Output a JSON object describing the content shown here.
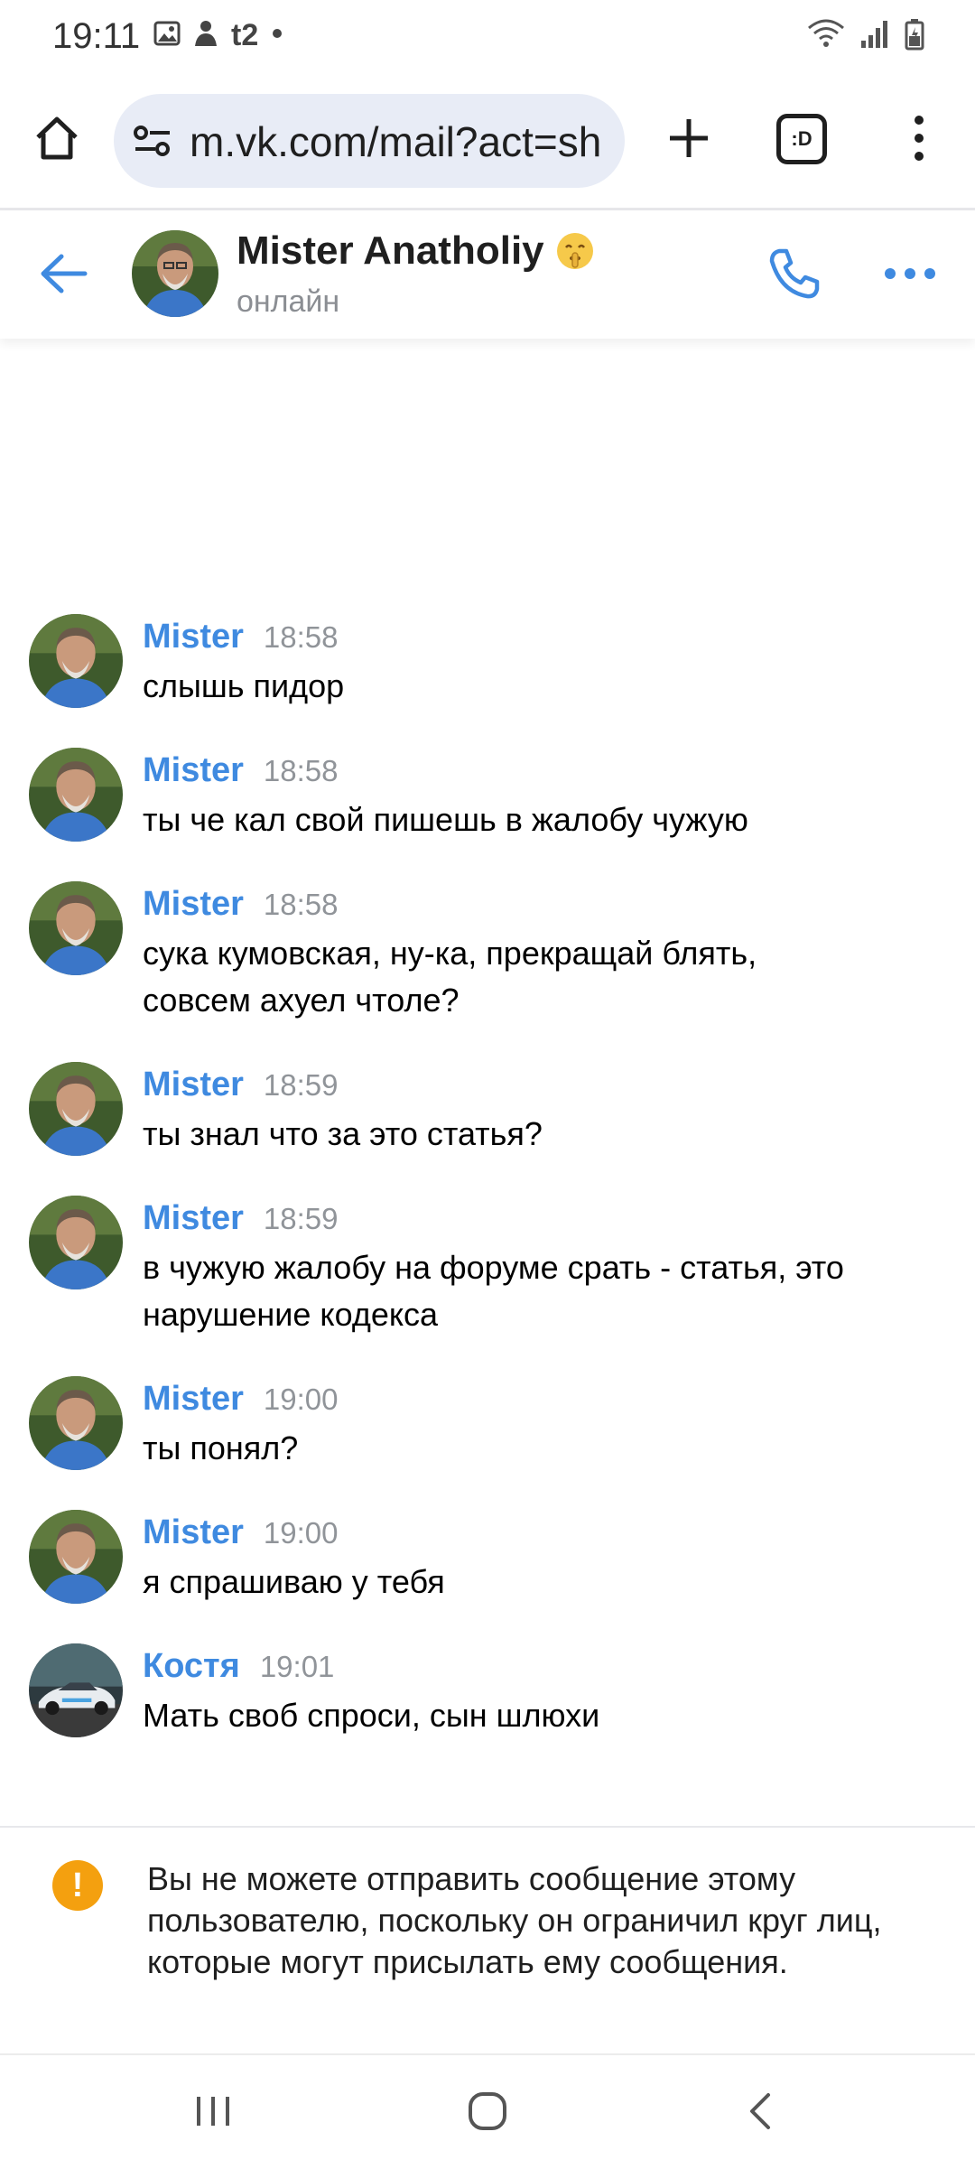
{
  "status_bar": {
    "time": "19:11",
    "carrier": "t2",
    "left_icons": [
      "gallery-icon",
      "notification-person-icon",
      "t2-icon",
      "dot-icon"
    ],
    "right_icons": [
      "wifi-icon",
      "signal-icon",
      "battery-icon"
    ]
  },
  "browser": {
    "url": "m.vk.com/mail?act=sh",
    "tab_count": ":D"
  },
  "chat_header": {
    "name": "Mister Anatholiy",
    "status": "онлайн",
    "emoji": "shushing-face-emoji"
  },
  "messages": [
    {
      "author": "Mister",
      "time": "18:58",
      "text": "слышь пидор",
      "avatar": "old-man"
    },
    {
      "author": "Mister",
      "time": "18:58",
      "text": "ты че кал свой пишешь в жалобу чужую",
      "avatar": "old-man"
    },
    {
      "author": "Mister",
      "time": "18:58",
      "text": "сука кумовская, ну-ка, прекращай блять,\nсовсем ахуел чтоле?",
      "avatar": "old-man"
    },
    {
      "author": "Mister",
      "time": "18:59",
      "text": "ты знал что за это статья?",
      "avatar": "old-man"
    },
    {
      "author": "Mister",
      "time": "18:59",
      "text": "в чужую жалобу на форуме срать - статья, это\nнарушение кодекса",
      "avatar": "old-man"
    },
    {
      "author": "Mister",
      "time": "19:00",
      "text": "ты понял?",
      "avatar": "old-man"
    },
    {
      "author": "Mister",
      "time": "19:00",
      "text": "я спрашиваю у тебя",
      "avatar": "old-man"
    },
    {
      "author": "Костя",
      "time": "19:01",
      "text": "Мать своб спроси, сын шлюхи",
      "avatar": "car"
    }
  ],
  "notice": {
    "icon": "!",
    "text": "Вы не можете отправить сообщение этому пользователю, поскольку он ограничил круг лиц, которые могут присылать ему сообщения."
  },
  "colors": {
    "accent": "#3f8ae0",
    "muted": "#909499",
    "warning": "#f4a00f"
  }
}
